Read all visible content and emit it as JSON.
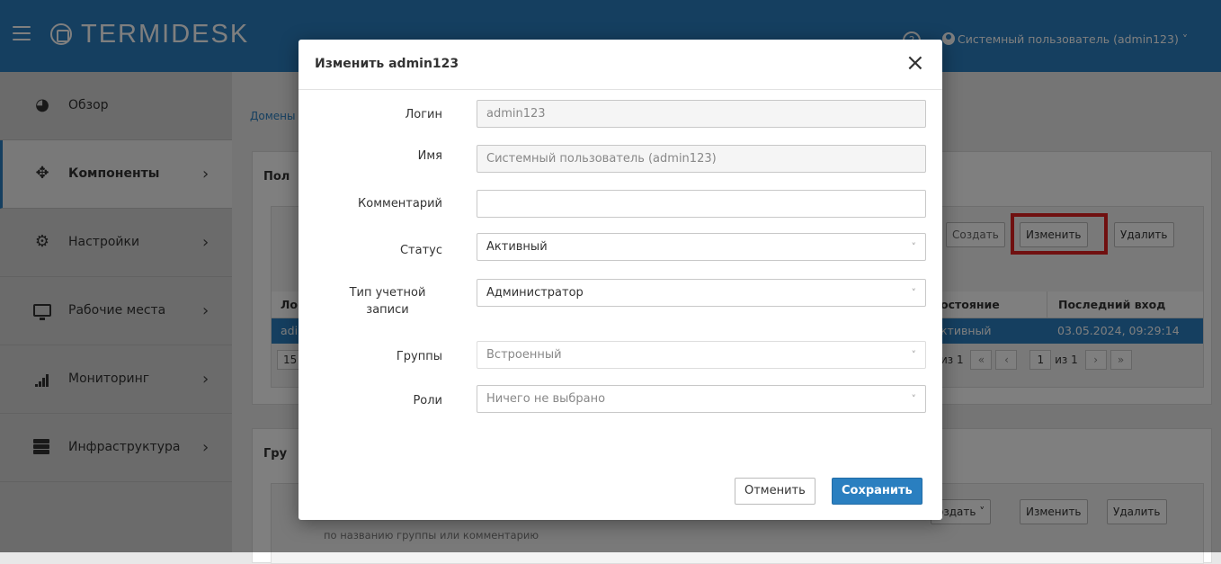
{
  "app": {
    "logo_text": "TERMIDESK",
    "help_glyph": "?",
    "user_label": "Системный пользователь (admin123) ˅"
  },
  "sidebar": {
    "items": [
      {
        "label": "Обзор",
        "icon": "dashboard-icon",
        "arrow": ""
      },
      {
        "label": "Компоненты",
        "icon": "components-icon",
        "arrow": "›"
      },
      {
        "label": "Настройки",
        "icon": "settings-icon",
        "arrow": "›"
      },
      {
        "label": "Рабочие места",
        "icon": "monitor-icon",
        "arrow": "›"
      },
      {
        "label": "Мониторинг",
        "icon": "monitoring-icon",
        "arrow": "›"
      },
      {
        "label": "Инфраструктура",
        "icon": "infrastructure-icon",
        "arrow": "›"
      }
    ]
  },
  "background": {
    "breadcrumb": "Домены",
    "panel1_title": "Пол",
    "panel1_buttons": {
      "create": "Создать",
      "edit": "Изменить",
      "delete": "Удалить"
    },
    "table_headers": {
      "login": "Ло",
      "state": "остояние",
      "last_login": "Последний вход"
    },
    "table_row": {
      "login": "adi",
      "state": "ктивный",
      "last_login": "03.05.2024, 09:29:14"
    },
    "pager": {
      "page_size": "15",
      "of_left": "из 1",
      "first": "«",
      "prev": "‹",
      "page": "1",
      "of_right": "из 1",
      "next": "›",
      "last": "»"
    },
    "panel2_title": "Гру",
    "panel2_buttons": {
      "create": "оздать ˅",
      "edit": "Изменить",
      "delete": "Удалить"
    },
    "panel2_hint": "по названию группы или комментарию"
  },
  "modal": {
    "title": "Изменить admin123",
    "close_glyph": "×",
    "fields": {
      "login": {
        "label": "Логин",
        "value": "admin123"
      },
      "name": {
        "label": "Имя",
        "value": "Системный пользователь (admin123)"
      },
      "comment": {
        "label": "Комментарий",
        "value": ""
      },
      "status": {
        "label": "Статус",
        "value": "Активный"
      },
      "account_type": {
        "label": "Тип учетной записи",
        "value": "Администратор"
      },
      "groups": {
        "label": "Группы",
        "value": "Встроенный"
      },
      "roles": {
        "label": "Роли",
        "value": "Ничего не выбрано"
      }
    },
    "chevron_glyph": "˅",
    "cancel_label": "Отменить",
    "save_label": "Сохранить"
  },
  "colors": {
    "brand": "#2a7fc0",
    "highlight": "#e02020"
  }
}
